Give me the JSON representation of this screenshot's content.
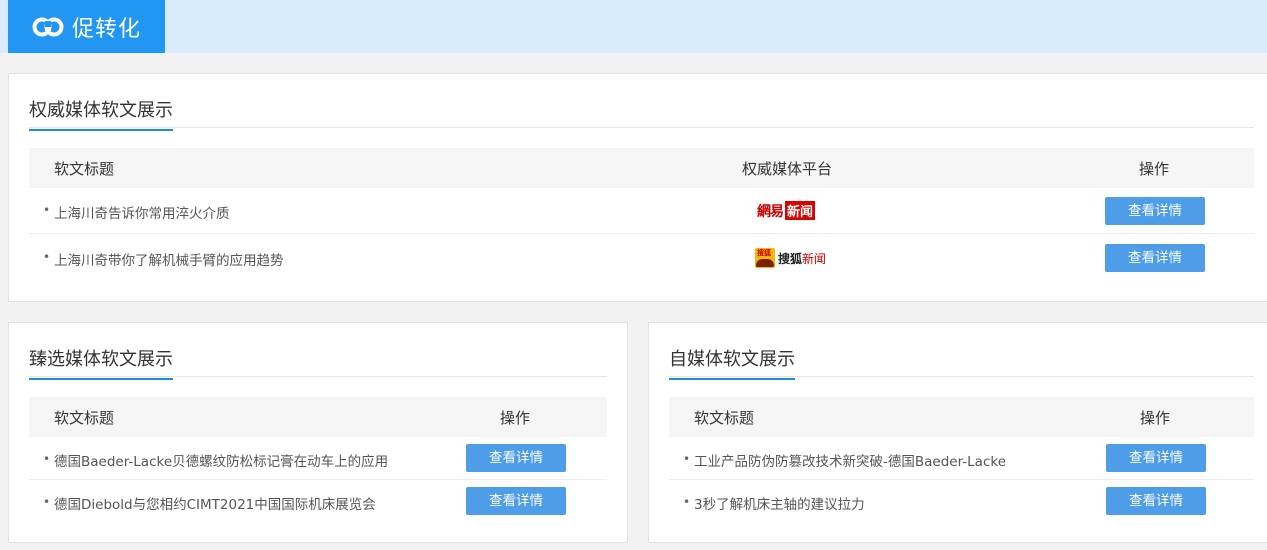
{
  "header": {
    "brand_title": "促转化",
    "brand_color": "#2196f3",
    "bar_color": "#d9ecff",
    "logo_icon": "link-icon"
  },
  "authority_section": {
    "title": "权威媒体软文展示",
    "columns": {
      "title": "软文标题",
      "platform": "权威媒体平台",
      "action": "操作"
    },
    "rows": [
      {
        "title": "上海川奇告诉你常用淬火介质",
        "platform_logo": "网易新闻",
        "platform_logo_text": "網易",
        "platform_logo_box": "新闻",
        "button": "查看详情"
      },
      {
        "title": "上海川奇带你了解机械手臂的应用趋势",
        "platform_logo": "搜狐新闻",
        "platform_logo_icon_text": "搜狐",
        "platform_logo_text": "搜狐",
        "platform_logo_red": "新闻",
        "button": "查看详情"
      }
    ]
  },
  "selected_section": {
    "title": "臻选媒体软文展示",
    "columns": {
      "title": "软文标题",
      "action": "操作"
    },
    "rows": [
      {
        "title": "德国Baeder-Lacke贝德螺纹防松标记膏在动车上的应用",
        "button": "查看详情"
      },
      {
        "title": "德国Diebold与您相约CIMT2021中国国际机床展览会",
        "button": "查看详情"
      }
    ]
  },
  "self_media_section": {
    "title": "自媒体软文展示",
    "columns": {
      "title": "软文标题",
      "action": "操作"
    },
    "rows": [
      {
        "title": "工业产品防伪防篡改技术新突破-德国Baeder-Lacke",
        "button": "查看详情"
      },
      {
        "title": "3秒了解机床主轴的建议拉力",
        "button": "查看详情"
      }
    ]
  },
  "accent_color": "#1e88e5",
  "button_color": "#4d9de8"
}
